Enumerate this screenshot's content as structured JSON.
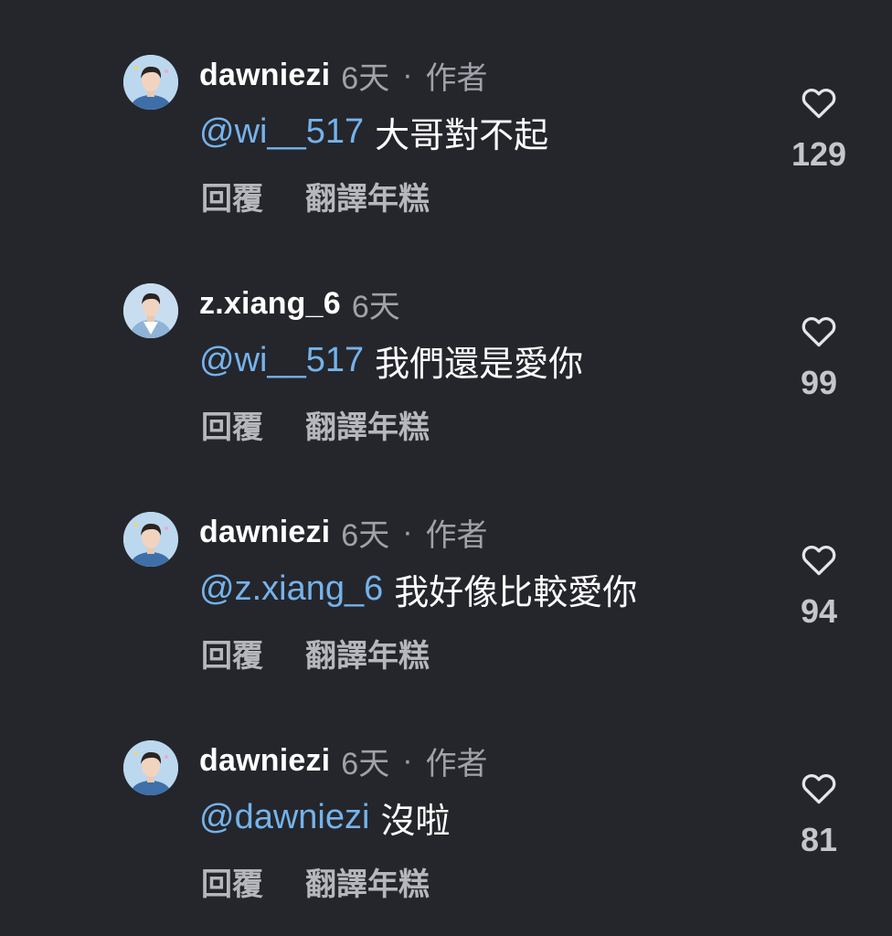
{
  "colors": {
    "background": "#25262b",
    "mention": "#74b3ec",
    "muted": "#a0a2a8"
  },
  "comments": [
    {
      "username": "dawniezi",
      "time": "6天",
      "author_dot": "·",
      "author_badge": "作者",
      "mention": "@wi__517",
      "text": "大哥對不起",
      "reply_label": "回覆",
      "translate_label": "翻譯年糕",
      "like_icon": "heart-outline-icon",
      "likes": "129"
    },
    {
      "username": "z.xiang_6",
      "time": "6天",
      "author_dot": "",
      "author_badge": "",
      "mention": "@wi__517",
      "text": "我們還是愛你",
      "reply_label": "回覆",
      "translate_label": "翻譯年糕",
      "like_icon": "heart-outline-icon",
      "likes": "99"
    },
    {
      "username": "dawniezi",
      "time": "6天",
      "author_dot": "·",
      "author_badge": "作者",
      "mention": "@z.xiang_6",
      "text": "我好像比較愛你",
      "reply_label": "回覆",
      "translate_label": "翻譯年糕",
      "like_icon": "heart-outline-icon",
      "likes": "94"
    },
    {
      "username": "dawniezi",
      "time": "6天",
      "author_dot": "·",
      "author_badge": "作者",
      "mention": "@dawniezi",
      "text": "沒啦",
      "reply_label": "回覆",
      "translate_label": "翻譯年糕",
      "like_icon": "heart-outline-icon",
      "likes": "81"
    }
  ]
}
